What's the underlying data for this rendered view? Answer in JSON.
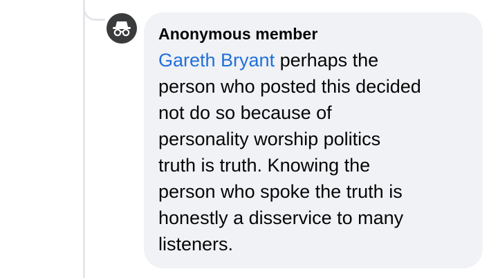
{
  "comment": {
    "avatar_icon": "incognito-icon",
    "author": "Anonymous member",
    "mention": "Gareth Bryant",
    "lines": [
      " perhaps the",
      "person who posted this decided",
      "not do so because of",
      "personality worship politics",
      "truth is truth. Knowing the",
      "person who spoke the truth is",
      "honestly a disservice to many",
      "listeners."
    ]
  },
  "colors": {
    "mention": "#216fdb",
    "bubble": "#f0f2f5",
    "avatar": "#3a3b3c",
    "text": "#050505"
  }
}
